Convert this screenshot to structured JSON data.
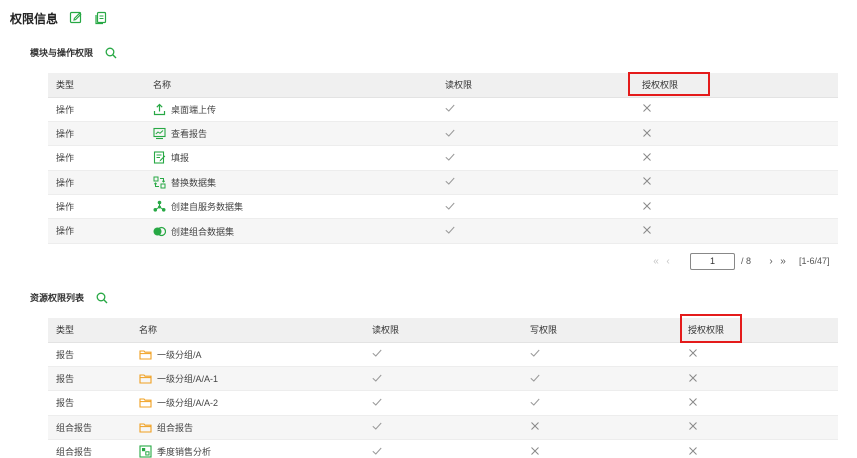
{
  "header": {
    "title": "权限信息",
    "icons": [
      "edit-icon",
      "copy-icon"
    ]
  },
  "section1": {
    "title": "模块与操作权限",
    "columns": [
      "类型",
      "名称",
      "读权限",
      "授权权限"
    ],
    "rows": [
      {
        "type": "操作",
        "icon": "upload-icon",
        "name": "桌面端上传",
        "read": "check",
        "grant": "cross"
      },
      {
        "type": "操作",
        "icon": "report-view-icon",
        "name": "查看报告",
        "read": "check",
        "grant": "cross"
      },
      {
        "type": "操作",
        "icon": "fill-form-icon",
        "name": "填报",
        "read": "check",
        "grant": "cross"
      },
      {
        "type": "操作",
        "icon": "replace-dataset-icon",
        "name": "替换数据集",
        "read": "check",
        "grant": "cross"
      },
      {
        "type": "操作",
        "icon": "self-service-dataset-icon",
        "name": "创建自服务数据集",
        "read": "check",
        "grant": "cross"
      },
      {
        "type": "操作",
        "icon": "combined-dataset-icon",
        "name": "创建组合数据集",
        "read": "check",
        "grant": "cross"
      }
    ]
  },
  "pager": {
    "current_page": "1",
    "total_pages": "/ 8",
    "range": "[1-6/47]"
  },
  "section2": {
    "title": "资源权限列表",
    "columns": [
      "类型",
      "名称",
      "读权限",
      "写权限",
      "授权权限"
    ],
    "rows": [
      {
        "type": "报告",
        "icon": "folder-icon",
        "name": "一级分组/A",
        "read": "check",
        "write": "check",
        "grant": "cross"
      },
      {
        "type": "报告",
        "icon": "folder-icon",
        "name": "一级分组/A/A-1",
        "read": "check",
        "write": "check",
        "grant": "cross"
      },
      {
        "type": "报告",
        "icon": "folder-icon",
        "name": "一级分组/A/A-2",
        "read": "check",
        "write": "check",
        "grant": "cross"
      },
      {
        "type": "组合报告",
        "icon": "folder-icon",
        "name": "组合报告",
        "read": "check",
        "write": "cross",
        "grant": "cross"
      },
      {
        "type": "组合报告",
        "icon": "combined-report-icon",
        "name": "季度销售分析",
        "read": "check",
        "write": "cross",
        "grant": "cross"
      }
    ]
  },
  "colors": {
    "accent_green": "#27a844",
    "folder_orange": "#f0a020",
    "highlight_red": "#e41b1b",
    "header_bg": "#f0f0f0"
  }
}
